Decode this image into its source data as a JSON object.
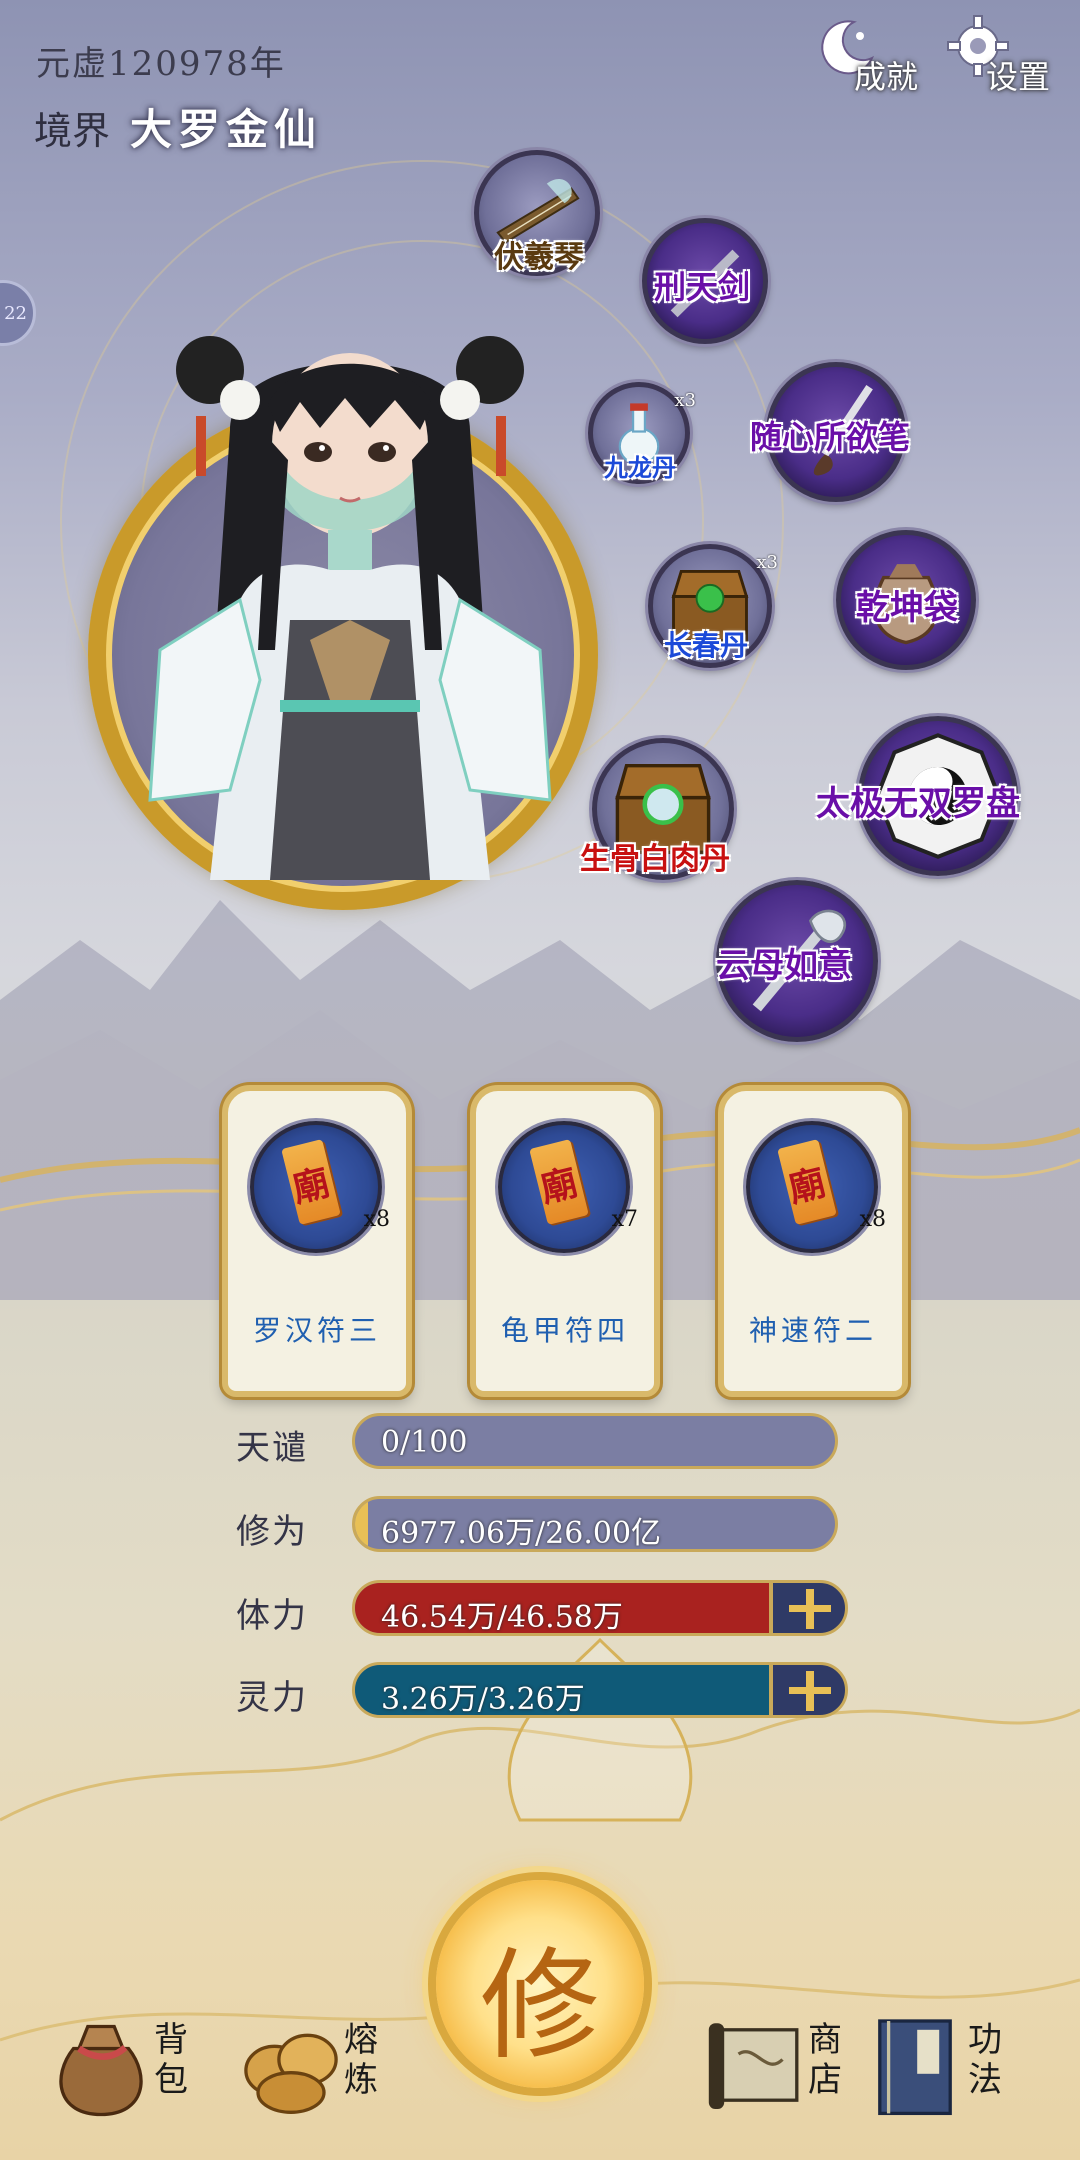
{
  "header": {
    "year": "元虚120978年",
    "realm_label": "境界",
    "realm_value": "大罗金仙",
    "achievements_label": "成就",
    "settings_label": "设置",
    "side_badge": "22"
  },
  "equipment": [
    {
      "name": "伏羲琴",
      "qty": ""
    },
    {
      "name": "刑天剑",
      "qty": ""
    },
    {
      "name": "九龙丹",
      "qty": "x3"
    },
    {
      "name": "随心所欲笔",
      "qty": ""
    },
    {
      "name": "长春丹",
      "qty": "x3"
    },
    {
      "name": "乾坤袋",
      "qty": ""
    },
    {
      "name": "生骨白肉丹",
      "qty": ""
    },
    {
      "name": "太极无双罗盘",
      "qty": ""
    },
    {
      "name": "云母如意",
      "qty": ""
    }
  ],
  "talismans": [
    {
      "name": "罗汉符三",
      "qty": "x8"
    },
    {
      "name": "龟甲符四",
      "qty": "x7"
    },
    {
      "name": "神速符二",
      "qty": "x8"
    }
  ],
  "stats": [
    {
      "label": "天谴",
      "value": "0/100",
      "fraction": 0.0,
      "color": "#7b7ea3"
    },
    {
      "label": "修为",
      "value": "6977.06万/26.00亿",
      "fraction": 0.027,
      "color": "#e8c056"
    },
    {
      "label": "体力",
      "value": "46.54万/46.58万",
      "fraction": 0.999,
      "color": "#a9221f"
    },
    {
      "label": "灵力",
      "value": "3.26万/3.26万",
      "fraction": 1.0,
      "color": "#0f5a78"
    }
  ],
  "nav": {
    "cultivate": "修",
    "bag": "背包",
    "smelt": "熔炼",
    "shop": "商店",
    "skills": "功法"
  }
}
